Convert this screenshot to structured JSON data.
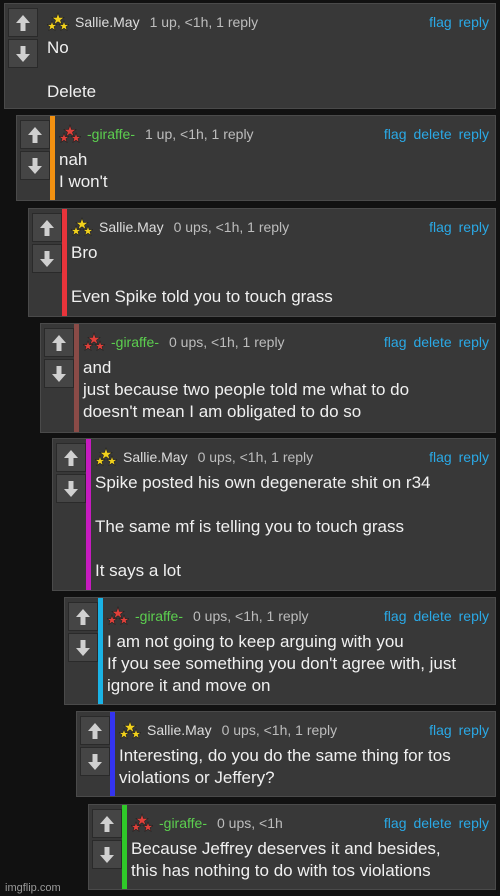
{
  "colors": {
    "bar_orange": "#f29111",
    "bar_red": "#e8343b",
    "bar_brown": "#8a4b47",
    "bar_magenta": "#c61bbf",
    "bar_cyan": "#1ab3e6",
    "bar_blue": "#3434f0",
    "bar_green": "#2fc929",
    "link": "#2aa9e6"
  },
  "icons": {
    "upvote": "arrow-up-icon",
    "downvote": "arrow-down-icon",
    "avatar": "three-stars-avatar-icon"
  },
  "comments": [
    {
      "user": "Sallie.May",
      "meta": "1 up, <1h, 1 reply",
      "actions": [
        "flag",
        "reply"
      ],
      "lines": [
        "No",
        "",
        "Delete"
      ]
    },
    {
      "user": "-giraffe-",
      "meta": "1 up, <1h, 1 reply",
      "actions": [
        "flag",
        "delete",
        "reply"
      ],
      "lines": [
        "nah",
        "I won't"
      ]
    },
    {
      "user": "Sallie.May",
      "meta": "0 ups, <1h, 1 reply",
      "actions": [
        "flag",
        "reply"
      ],
      "lines": [
        "Bro",
        "",
        "Even Spike told you to touch grass"
      ]
    },
    {
      "user": "-giraffe-",
      "meta": "0 ups, <1h, 1 reply",
      "actions": [
        "flag",
        "delete",
        "reply"
      ],
      "lines": [
        "and",
        "just because two people told me what to do",
        "doesn't mean I am obligated to do so"
      ]
    },
    {
      "user": "Sallie.May",
      "meta": "0 ups, <1h, 1 reply",
      "actions": [
        "flag",
        "reply"
      ],
      "lines": [
        "Spike posted his own degenerate shit on r34",
        "",
        "The same mf is telling you to touch grass",
        "",
        "It says a lot"
      ]
    },
    {
      "user": "-giraffe-",
      "meta": "0 ups, <1h, 1 reply",
      "actions": [
        "flag",
        "delete",
        "reply"
      ],
      "lines": [
        "I am not going to keep arguing with you",
        "If you see something you don't agree with, just",
        "ignore it and move on"
      ]
    },
    {
      "user": "Sallie.May",
      "meta": "0 ups, <1h, 1 reply",
      "actions": [
        "flag",
        "reply"
      ],
      "lines": [
        "Interesting, do you do the same thing for tos",
        "violations or Jeffery?"
      ]
    },
    {
      "user": "-giraffe-",
      "meta": "0 ups, <1h",
      "actions": [
        "flag",
        "delete",
        "reply"
      ],
      "lines": [
        "Because Jeffrey deserves it and besides,",
        "this has nothing to do with tos violations"
      ]
    }
  ],
  "watermark": "imgflip.com"
}
